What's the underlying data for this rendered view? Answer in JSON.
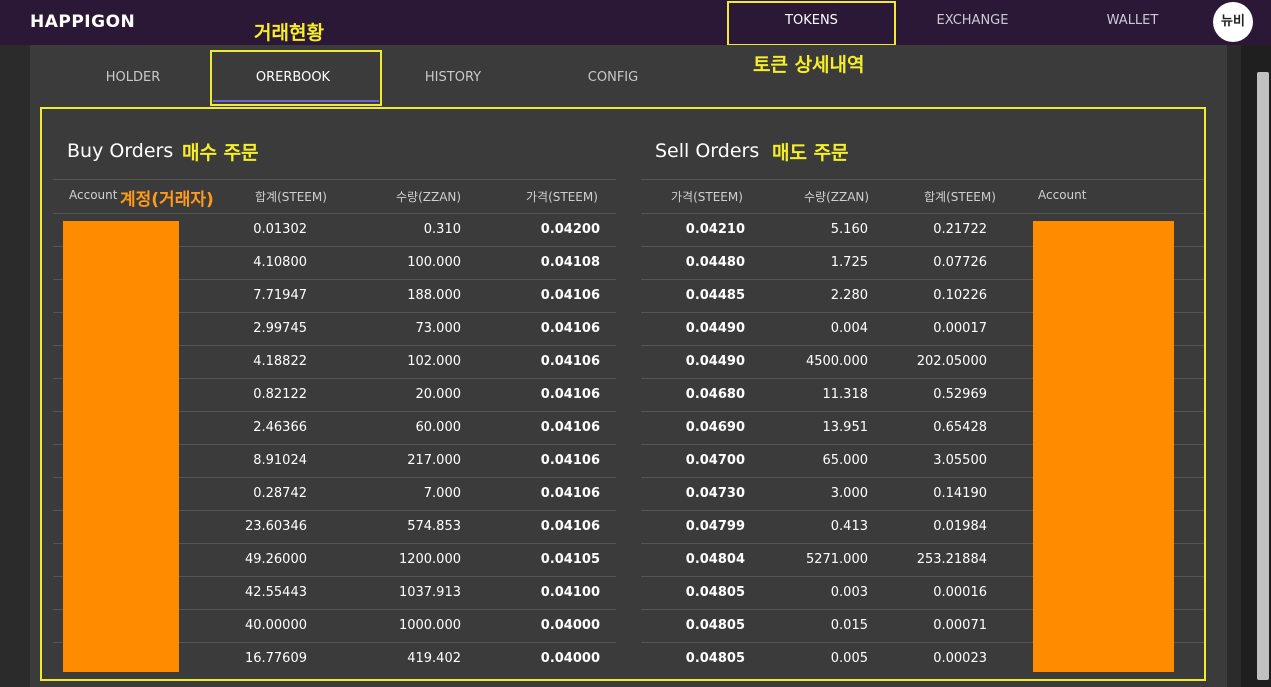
{
  "app": {
    "logo": "HAPPIGON"
  },
  "nav": {
    "tokens": "TOKENS",
    "exchange": "EXCHANGE",
    "wallet": "WALLET",
    "avatar": "뉴비"
  },
  "annotations": {
    "trade_status": "거래현황",
    "token_detail": "토큰 상세내역",
    "buy_orders": "매수 주문",
    "sell_orders": "매도 주문",
    "account": "계정(거래자)"
  },
  "tabs": [
    "HOLDER",
    "ORERBOOK",
    "HISTORY",
    "CONFIG"
  ],
  "buy": {
    "title": "Buy Orders",
    "headers": {
      "account": "Account",
      "total": "합계(STEEM)",
      "amount": "수량(ZZAN)",
      "price": "가격(STEEM)"
    },
    "rows": [
      [
        "0.01302",
        "0.310",
        "0.04200"
      ],
      [
        "4.10800",
        "100.000",
        "0.04108"
      ],
      [
        "7.71947",
        "188.000",
        "0.04106"
      ],
      [
        "2.99745",
        "73.000",
        "0.04106"
      ],
      [
        "4.18822",
        "102.000",
        "0.04106"
      ],
      [
        "0.82122",
        "20.000",
        "0.04106"
      ],
      [
        "2.46366",
        "60.000",
        "0.04106"
      ],
      [
        "8.91024",
        "217.000",
        "0.04106"
      ],
      [
        "0.28742",
        "7.000",
        "0.04106"
      ],
      [
        "23.60346",
        "574.853",
        "0.04106"
      ],
      [
        "49.26000",
        "1200.000",
        "0.04105"
      ],
      [
        "42.55443",
        "1037.913",
        "0.04100"
      ],
      [
        "40.00000",
        "1000.000",
        "0.04000"
      ],
      [
        "16.77609",
        "419.402",
        "0.04000"
      ]
    ]
  },
  "sell": {
    "title": "Sell Orders",
    "headers": {
      "price": "가격(STEEM)",
      "amount": "수량(ZZAN)",
      "total": "합계(STEEM)",
      "account": "Account"
    },
    "rows": [
      [
        "0.04210",
        "5.160",
        "0.21722"
      ],
      [
        "0.04480",
        "1.725",
        "0.07726"
      ],
      [
        "0.04485",
        "2.280",
        "0.10226"
      ],
      [
        "0.04490",
        "0.004",
        "0.00017"
      ],
      [
        "0.04490",
        "4500.000",
        "202.05000"
      ],
      [
        "0.04680",
        "11.318",
        "0.52969"
      ],
      [
        "0.04690",
        "13.951",
        "0.65428"
      ],
      [
        "0.04700",
        "65.000",
        "3.05500"
      ],
      [
        "0.04730",
        "3.000",
        "0.14190"
      ],
      [
        "0.04799",
        "0.413",
        "0.01984"
      ],
      [
        "0.04804",
        "5271.000",
        "253.21884"
      ],
      [
        "0.04805",
        "0.003",
        "0.00016"
      ],
      [
        "0.04805",
        "0.015",
        "0.00071"
      ],
      [
        "0.04805",
        "0.005",
        "0.00023"
      ]
    ]
  },
  "colors": {
    "redaction": "#ff8c00",
    "highlight": "#f2ea2e",
    "nav_bg": "#2b1837"
  }
}
